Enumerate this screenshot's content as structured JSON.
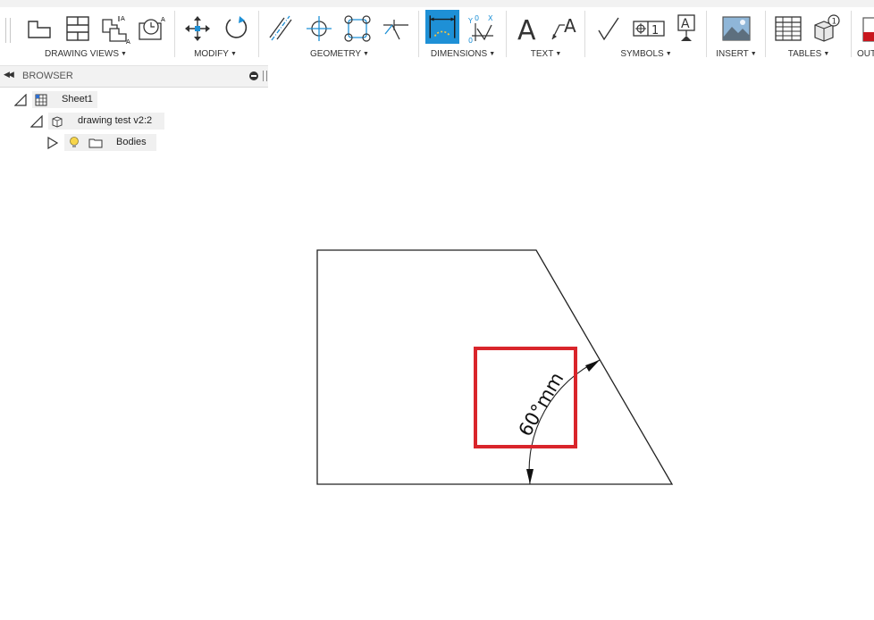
{
  "toolbar": {
    "groups": [
      {
        "label": "DRAWING VIEWS"
      },
      {
        "label": "MODIFY"
      },
      {
        "label": "GEOMETRY"
      },
      {
        "label": "DIMENSIONS"
      },
      {
        "label": "TEXT"
      },
      {
        "label": "SYMBOLS"
      },
      {
        "label": "INSERT"
      },
      {
        "label": "TABLES"
      },
      {
        "label": "OUT"
      }
    ],
    "icons": {
      "base_view": "base-view-icon",
      "projected_view": "projected-view-icon",
      "section_view": "section-view-icon",
      "detail_view": "detail-view-icon",
      "move": "move-icon",
      "rotate": "rotate-icon",
      "centerline": "centerline-icon",
      "center_mark": "center-mark-icon",
      "center_mark_pattern": "center-mark-pattern-icon",
      "edge_extension": "edge-extension-icon",
      "dimension": "dimension-icon",
      "ordinate_dimension": "ordinate-dimension-icon",
      "text": "text-icon",
      "leader": "leader-icon",
      "surface_texture": "surface-texture-icon",
      "feature_control_frame": "feature-control-frame-icon",
      "datum_identifier": "datum-identifier-icon",
      "insert_image": "insert-image-icon",
      "table": "table-icon",
      "balloon": "balloon-icon",
      "output_pdf": "output-pdf-icon"
    },
    "text_letter": "A",
    "datum_letter": "A",
    "fcf_number": "1",
    "balloon_number": "1",
    "ordinate_y": "Y",
    "ordinate_x": "X",
    "ordinate_zero1": "0",
    "ordinate_zero2": "0",
    "accent_color": "#1e90d6"
  },
  "browser": {
    "title": "BROWSER",
    "tree": [
      {
        "label": "Sheet1",
        "expanded": true
      },
      {
        "label": "drawing test v2:2",
        "expanded": true
      },
      {
        "label": "Bodies",
        "expanded": false
      }
    ]
  },
  "drawing": {
    "dimension_text": "60°mm",
    "highlight_color": "#d9252b"
  }
}
